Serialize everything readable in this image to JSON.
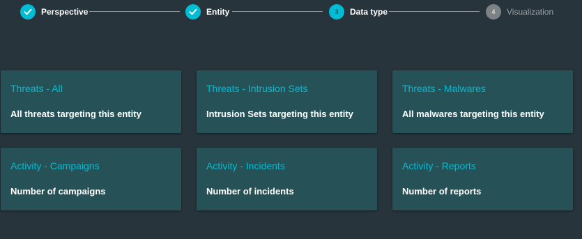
{
  "stepper": {
    "steps": [
      {
        "number": "1",
        "label": "Perspective",
        "state": "done",
        "icon": "check-icon"
      },
      {
        "number": "2",
        "label": "Entity",
        "state": "done",
        "icon": "check-icon"
      },
      {
        "number": "3",
        "label": "Data type",
        "state": "active"
      },
      {
        "number": "4",
        "label": "Visualization",
        "state": "pending"
      }
    ]
  },
  "cards": [
    {
      "title": "Threats - All",
      "description": "All threats targeting this entity"
    },
    {
      "title": "Threats - Intrusion Sets",
      "description": "Intrusion Sets targeting this entity"
    },
    {
      "title": "Threats - Malwares",
      "description": "All malwares targeting this entity"
    },
    {
      "title": "Activity - Campaigns",
      "description": "Number of campaigns"
    },
    {
      "title": "Activity - Incidents",
      "description": "Number of incidents"
    },
    {
      "title": "Activity - Reports",
      "description": "Number of reports"
    }
  ],
  "colors": {
    "background": "#28343b",
    "card": "#265257",
    "accent": "#00bcd4",
    "pending": "#7c8286"
  }
}
